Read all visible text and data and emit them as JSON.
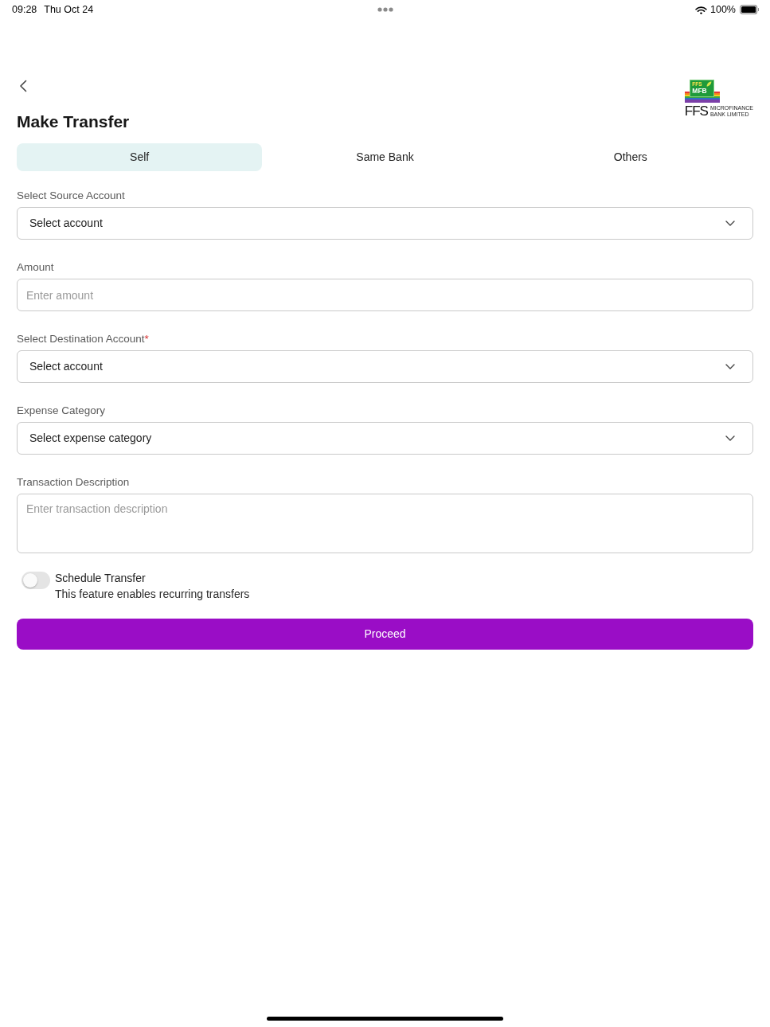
{
  "status_bar": {
    "time": "09:28",
    "date": "Thu Oct 24",
    "battery": "100%"
  },
  "header": {
    "title": "Make Transfer",
    "logo": {
      "badge_top": "FFS",
      "badge_label": "MFB",
      "name": "FFS",
      "tagline": [
        "MICROFINANCE",
        "BANK LIMITED"
      ]
    }
  },
  "tabs": [
    {
      "label": "Self",
      "selected": true
    },
    {
      "label": "Same Bank",
      "selected": false
    },
    {
      "label": "Others",
      "selected": false
    }
  ],
  "fields": [
    {
      "kind": "select",
      "label": "Select Source Account",
      "value": "Select account"
    },
    {
      "kind": "input",
      "label": "Amount",
      "placeholder": "Enter amount"
    },
    {
      "kind": "select",
      "label": "Select Destination Account",
      "required_mark": "*",
      "value": "Select account"
    },
    {
      "kind": "select",
      "label": "Expense Category",
      "value": "Select expense category"
    },
    {
      "kind": "textarea",
      "label": "Transaction Description",
      "placeholder": "Enter transaction description"
    }
  ],
  "schedule": {
    "title": "Schedule Transfer",
    "description": "This feature enables recurring transfers",
    "on": false
  },
  "button": "Proceed"
}
